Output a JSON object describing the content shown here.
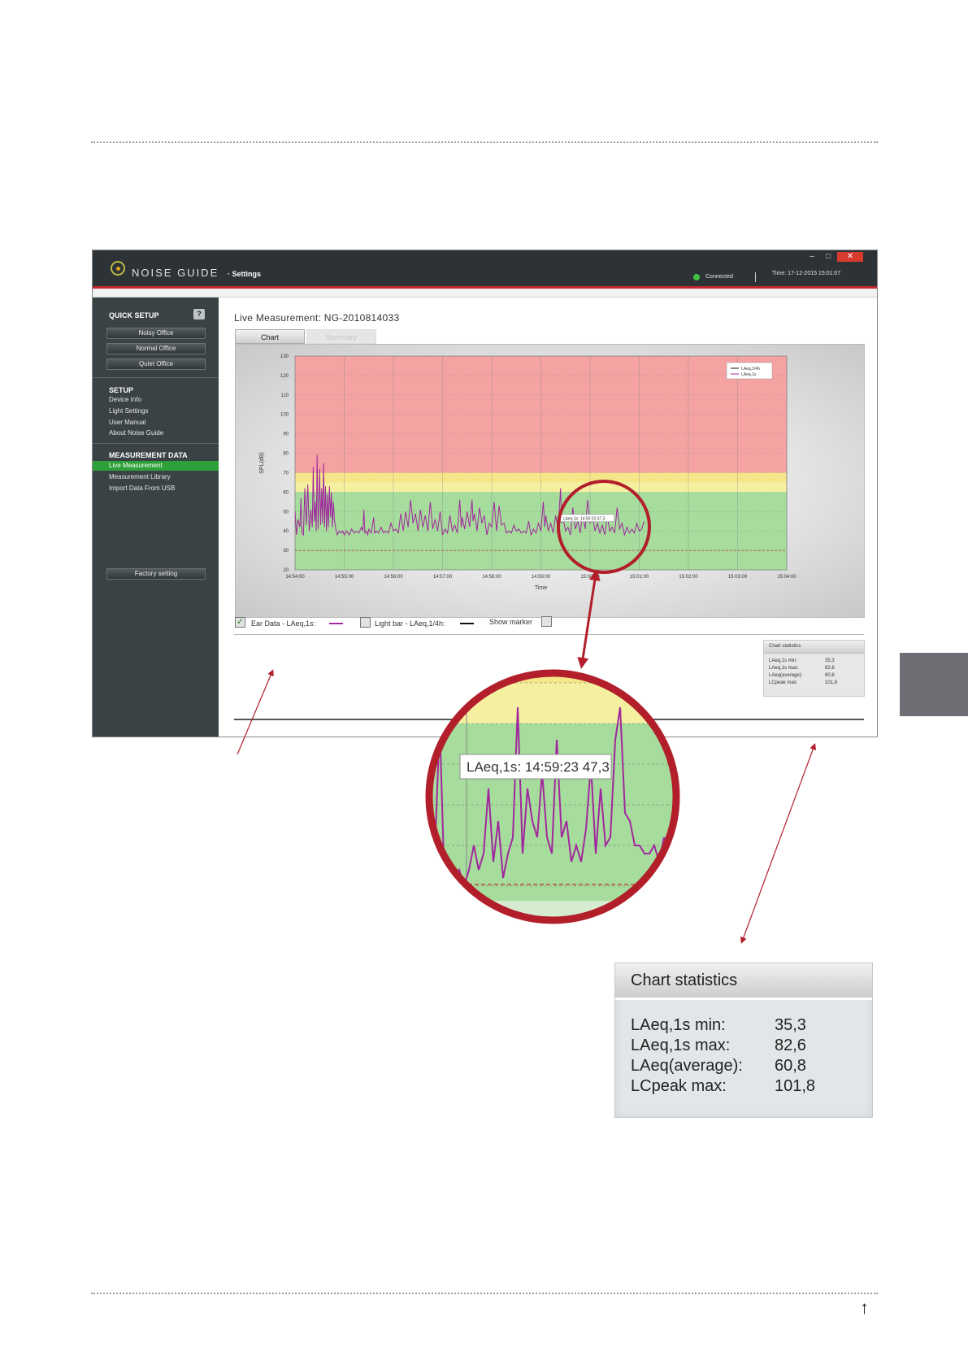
{
  "app": {
    "brand": "NOISE GUIDE",
    "brand_sub": "· Settings",
    "connection_status": "Connected",
    "time": "Time: 17-12-2015 15:01:07",
    "window_buttons": {
      "minimize": "–",
      "maximize": "□",
      "close": "✕"
    }
  },
  "sidebar": {
    "quick_setup": {
      "heading": "QUICK SETUP",
      "help": "?",
      "buttons": [
        "Noisy Office",
        "Normal Office",
        "Quiet Office"
      ]
    },
    "setup": {
      "heading": "SETUP",
      "items": [
        "Device Info",
        "Light Settings",
        "User Manual",
        "About Noise Guide"
      ]
    },
    "measurement_data": {
      "heading": "MEASUREMENT DATA",
      "items": [
        "Live Measurement",
        "Measurement Library",
        "Import Data From USB"
      ],
      "active_index": 0
    },
    "factory_button": "Factory setting"
  },
  "main": {
    "title": "Live Measurement: NG-2010814033",
    "tabs": [
      {
        "label": "Chart",
        "active": true
      },
      {
        "label": "Summary",
        "active": false
      }
    ],
    "tooltip_small": "LAeq,1s: 14:59:23 47,3",
    "options": {
      "ear_data_label": "Ear Data - LAeq,1s:",
      "ear_data_checked": true,
      "light_bar_label": "Light bar - LAeq,1/4h:",
      "light_bar_checked": false,
      "show_marker_label": "Show marker",
      "show_marker_checked": false
    }
  },
  "chart_data": {
    "type": "line",
    "xlabel": "Time",
    "ylabel": "SPL(dB)",
    "ylim": [
      20,
      130
    ],
    "yticks": [
      "20",
      "30",
      "40",
      "50",
      "60",
      "70",
      "80",
      "90",
      "100",
      "110",
      "120",
      "130"
    ],
    "xticks": [
      "14:54:00",
      "14:55:00",
      "14:56:00",
      "14:57:00",
      "14:58:00",
      "14:59:00",
      "15:00:00",
      "15:01:00",
      "15:02:00",
      "15:03:00",
      "15:04:00"
    ],
    "zones": [
      {
        "from": 20,
        "to": 60,
        "color": "#a6dc9c"
      },
      {
        "from": 60,
        "to": 65,
        "color": "#f4f0a0"
      },
      {
        "from": 65,
        "to": 70,
        "color": "#f6e68a"
      },
      {
        "from": 70,
        "to": 130,
        "color": "#f4a2a2"
      }
    ],
    "reference_line": 30,
    "legend": [
      "LAeq,1/4h",
      "LAeq,1s"
    ],
    "series": [
      {
        "name": "LAeq,1s",
        "color": "#a2279e",
        "points": [
          [
            0,
            50
          ],
          [
            0.03,
            38
          ],
          [
            0.06,
            46
          ],
          [
            0.1,
            42
          ],
          [
            0.12,
            57
          ],
          [
            0.14,
            39
          ],
          [
            0.17,
            38
          ],
          [
            0.2,
            62
          ],
          [
            0.23,
            43
          ],
          [
            0.26,
            64
          ],
          [
            0.29,
            40
          ],
          [
            0.32,
            51
          ],
          [
            0.35,
            42
          ],
          [
            0.37,
            73
          ],
          [
            0.39,
            45
          ],
          [
            0.41,
            55
          ],
          [
            0.43,
            40
          ],
          [
            0.45,
            79
          ],
          [
            0.47,
            41
          ],
          [
            0.5,
            72
          ],
          [
            0.52,
            43
          ],
          [
            0.54,
            62
          ],
          [
            0.56,
            44
          ],
          [
            0.58,
            75
          ],
          [
            0.6,
            42
          ],
          [
            0.62,
            63
          ],
          [
            0.64,
            40
          ],
          [
            0.66,
            59
          ],
          [
            0.68,
            42
          ],
          [
            0.7,
            63
          ],
          [
            0.72,
            47
          ],
          [
            0.74,
            60
          ],
          [
            0.76,
            42
          ],
          [
            0.78,
            55
          ],
          [
            0.8,
            46
          ],
          [
            0.83,
            41
          ],
          [
            0.86,
            38
          ],
          [
            0.9,
            40
          ],
          [
            0.94,
            39
          ],
          [
            0.97,
            40
          ],
          [
            1.0,
            38
          ],
          [
            1.05,
            40
          ],
          [
            1.1,
            38
          ],
          [
            1.15,
            41
          ],
          [
            1.2,
            39
          ],
          [
            1.25,
            40
          ],
          [
            1.3,
            39
          ],
          [
            1.35,
            42
          ],
          [
            1.38,
            40
          ],
          [
            1.4,
            51
          ],
          [
            1.42,
            39
          ],
          [
            1.45,
            40
          ],
          [
            1.48,
            38
          ],
          [
            1.5,
            41
          ],
          [
            1.55,
            39
          ],
          [
            1.6,
            47
          ],
          [
            1.62,
            39
          ],
          [
            1.65,
            40
          ],
          [
            1.7,
            39
          ],
          [
            1.75,
            42
          ],
          [
            1.8,
            39
          ],
          [
            1.85,
            40
          ],
          [
            1.9,
            39
          ],
          [
            1.95,
            44
          ],
          [
            2.0,
            40
          ],
          [
            2.05,
            41
          ],
          [
            2.1,
            39
          ],
          [
            2.15,
            49
          ],
          [
            2.2,
            40
          ],
          [
            2.25,
            50
          ],
          [
            2.3,
            42
          ],
          [
            2.35,
            56
          ],
          [
            2.4,
            44
          ],
          [
            2.45,
            49
          ],
          [
            2.5,
            40
          ],
          [
            2.55,
            51
          ],
          [
            2.6,
            42
          ],
          [
            2.65,
            48
          ],
          [
            2.7,
            40
          ],
          [
            2.75,
            55
          ],
          [
            2.8,
            41
          ],
          [
            2.85,
            46
          ],
          [
            2.9,
            40
          ],
          [
            2.95,
            50
          ],
          [
            3.0,
            38
          ],
          [
            3.05,
            41
          ],
          [
            3.1,
            39
          ],
          [
            3.15,
            48
          ],
          [
            3.2,
            40
          ],
          [
            3.25,
            43
          ],
          [
            3.3,
            39
          ],
          [
            3.35,
            56
          ],
          [
            3.38,
            42
          ],
          [
            3.4,
            47
          ],
          [
            3.45,
            41
          ],
          [
            3.5,
            50
          ],
          [
            3.55,
            42
          ],
          [
            3.6,
            56
          ],
          [
            3.62,
            45
          ],
          [
            3.65,
            49
          ],
          [
            3.7,
            40
          ],
          [
            3.75,
            52
          ],
          [
            3.8,
            44
          ],
          [
            3.85,
            48
          ],
          [
            3.9,
            38
          ],
          [
            3.95,
            44
          ],
          [
            4.0,
            42
          ],
          [
            4.05,
            55
          ],
          [
            4.1,
            40
          ],
          [
            4.15,
            53
          ],
          [
            4.2,
            43
          ],
          [
            4.25,
            44
          ],
          [
            4.3,
            39
          ],
          [
            4.35,
            40
          ],
          [
            4.4,
            39
          ],
          [
            4.45,
            43
          ],
          [
            4.5,
            40
          ],
          [
            4.55,
            41
          ],
          [
            4.6,
            39
          ],
          [
            4.65,
            40
          ],
          [
            4.7,
            39
          ],
          [
            4.75,
            45
          ],
          [
            4.8,
            38
          ],
          [
            4.85,
            41
          ],
          [
            4.9,
            39
          ],
          [
            4.95,
            44
          ],
          [
            5.0,
            40
          ],
          [
            5.05,
            55
          ],
          [
            5.08,
            42
          ],
          [
            5.1,
            48
          ],
          [
            5.15,
            40
          ],
          [
            5.2,
            44
          ],
          [
            5.25,
            39
          ],
          [
            5.3,
            48
          ],
          [
            5.35,
            41
          ],
          [
            5.4,
            62
          ],
          [
            5.42,
            44
          ],
          [
            5.45,
            47
          ],
          [
            5.5,
            40
          ],
          [
            5.55,
            42
          ],
          [
            5.6,
            38
          ],
          [
            5.65,
            52
          ],
          [
            5.7,
            41
          ],
          [
            5.75,
            45
          ],
          [
            5.8,
            39
          ],
          [
            5.85,
            49
          ],
          [
            5.9,
            41
          ],
          [
            5.95,
            56
          ],
          [
            6.0,
            44
          ],
          [
            6.05,
            48
          ],
          [
            6.1,
            40
          ],
          [
            6.15,
            44
          ],
          [
            6.2,
            39
          ],
          [
            6.25,
            43
          ],
          [
            6.3,
            38
          ],
          [
            6.35,
            48
          ],
          [
            6.4,
            40
          ],
          [
            6.45,
            42
          ],
          [
            6.5,
            39
          ],
          [
            6.55,
            52
          ],
          [
            6.6,
            41
          ],
          [
            6.65,
            44
          ],
          [
            6.7,
            38
          ],
          [
            6.75,
            42
          ],
          [
            6.8,
            39
          ],
          [
            6.85,
            41
          ],
          [
            6.9,
            39
          ],
          [
            6.95,
            44
          ],
          [
            7.0,
            40
          ],
          [
            7.05,
            41
          ],
          [
            7.1,
            45
          ]
        ]
      }
    ]
  },
  "zoom": {
    "tooltip": "LAeq,1s: 14:59:23 47,3",
    "y_min": 35,
    "y_max": 67,
    "marker_time": 5.15,
    "series_points": [
      [
        4.85,
        48
      ],
      [
        4.87,
        44
      ],
      [
        4.89,
        60
      ],
      [
        4.91,
        40
      ],
      [
        4.93,
        39
      ],
      [
        4.95,
        41
      ],
      [
        4.97,
        42
      ],
      [
        4.99,
        40
      ],
      [
        5.01,
        42
      ],
      [
        5.03,
        45
      ],
      [
        5.05,
        42
      ],
      [
        5.07,
        44
      ],
      [
        5.09,
        52
      ],
      [
        5.11,
        43
      ],
      [
        5.13,
        48
      ],
      [
        5.15,
        41
      ],
      [
        5.17,
        44
      ],
      [
        5.19,
        46
      ],
      [
        5.21,
        62
      ],
      [
        5.23,
        44
      ],
      [
        5.25,
        52
      ],
      [
        5.27,
        48
      ],
      [
        5.29,
        46
      ],
      [
        5.31,
        54
      ],
      [
        5.33,
        46
      ],
      [
        5.35,
        44
      ],
      [
        5.37,
        58
      ],
      [
        5.39,
        46
      ],
      [
        5.41,
        48
      ],
      [
        5.43,
        43
      ],
      [
        5.45,
        45
      ],
      [
        5.47,
        43
      ],
      [
        5.49,
        47
      ],
      [
        5.51,
        55
      ],
      [
        5.53,
        44
      ],
      [
        5.55,
        52
      ],
      [
        5.57,
        45
      ],
      [
        5.59,
        46
      ],
      [
        5.61,
        58
      ],
      [
        5.63,
        62
      ],
      [
        5.65,
        49
      ],
      [
        5.67,
        48
      ],
      [
        5.69,
        45
      ],
      [
        5.71,
        45
      ],
      [
        5.73,
        44
      ],
      [
        5.75,
        44
      ],
      [
        5.77,
        45
      ],
      [
        5.79,
        43
      ],
      [
        5.81,
        46
      ],
      [
        5.83,
        43
      ],
      [
        5.85,
        45
      ]
    ]
  },
  "statistics": {
    "title": "Chart statistics",
    "rows": [
      {
        "label": "LAeq,1s min:",
        "value": "35,3"
      },
      {
        "label": "LAeq,1s max:",
        "value": "82,6"
      },
      {
        "label": "LAeq(average):",
        "value": "60,8"
      },
      {
        "label": "LCpeak max:",
        "value": "101,8"
      }
    ]
  },
  "colors": {
    "accent_red": "#b21f2b",
    "active_green": "#2ea03a",
    "series_purple": "#a2279e",
    "side_tab": "#6d6f74"
  },
  "icons": {
    "page_arrow": "arrow-up-icon",
    "check": "check-icon"
  }
}
